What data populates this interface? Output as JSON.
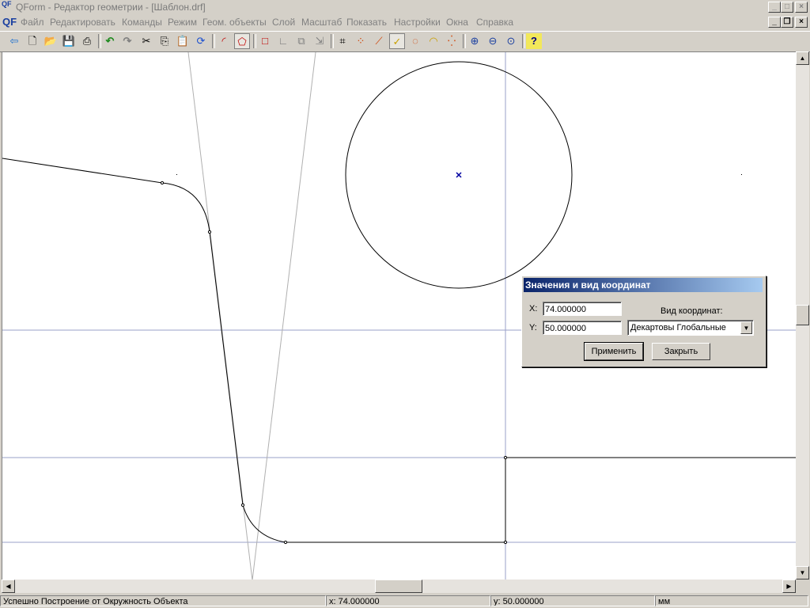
{
  "window": {
    "app_icon": "QF",
    "title": "QForm - Редактор геометрии - [Шаблон.drf]",
    "controls": {
      "minimize": "_",
      "maximize": "□",
      "close": "×",
      "restore": "❐"
    }
  },
  "menu": {
    "mdi_icon": "QF",
    "items": [
      "Файл",
      "Редактировать",
      "Команды",
      "Режим",
      "Геом. объекты",
      "Слой",
      "Масштаб",
      "Показать",
      "Настройки",
      "Окна",
      "Справка"
    ]
  },
  "toolbar": {
    "icons": [
      "exit-icon",
      "new-file-icon",
      "open-file-icon",
      "save-icon",
      "print-icon",
      "undo-icon",
      "redo-icon",
      "cut-icon",
      "copy-icon",
      "paste-icon",
      "refresh-icon",
      "arc-icon",
      "polygon-icon",
      "rectangle-icon",
      "corner-icon",
      "group-icon",
      "move-icon",
      "trim-icon",
      "point-snap-icon",
      "line-snap-icon",
      "check-snap-icon",
      "circle-snap-icon",
      "arc-snap-icon",
      "node-snap-icon",
      "zoom-in-icon",
      "zoom-out-icon",
      "zoom-window-icon",
      "help-icon"
    ],
    "glyphs": [
      "⇦",
      "🗋",
      "📂",
      "💾",
      "⎙",
      "↶",
      "↷",
      "✂",
      "⎘",
      "📋",
      "⟳",
      "◜",
      "⬠",
      "□",
      "∟",
      "⧉",
      "⇲",
      "⌗",
      "⁘",
      "⟋",
      "✓",
      "◌",
      "◠",
      "⁛",
      "⊕",
      "⊖",
      "⊙",
      "?"
    ]
  },
  "dialog": {
    "title": "Значения и вид координат",
    "x_label": "X:",
    "x_value": "74.000000",
    "y_label": "Y:",
    "y_value": "50.000000",
    "coord_type_label": "Вид координат:",
    "coord_type_selected": "Декартовы Глобальные",
    "apply_label": "Применить",
    "close_label": "Закрыть"
  },
  "status": {
    "message": "Успешно Построение от Окружность Объекта",
    "x": "x: 74.000000",
    "y": "y: 50.000000",
    "units": "мм"
  },
  "colors": {
    "accent": "#0a246a",
    "geometry": "#000000",
    "guide_lines": "#9aa0c8",
    "center_marker": "#0000a0"
  }
}
